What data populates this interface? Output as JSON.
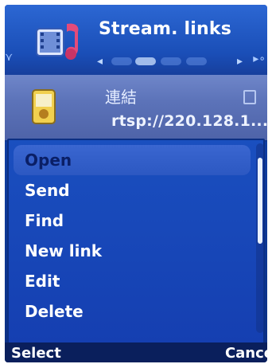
{
  "header": {
    "title": "Stream. links",
    "app_icon": "media-film-note-icon"
  },
  "item": {
    "title": "連結",
    "url": "rtsp://220.128.1...",
    "icon": "media-file-icon"
  },
  "menu": {
    "items": [
      {
        "label": "Open",
        "selected": true
      },
      {
        "label": "Send",
        "selected": false
      },
      {
        "label": "Find",
        "selected": false
      },
      {
        "label": "New link",
        "selected": false
      },
      {
        "label": "Edit",
        "selected": false
      },
      {
        "label": "Delete",
        "selected": false
      }
    ]
  },
  "softkeys": {
    "left": "Select",
    "right": "Cance"
  }
}
